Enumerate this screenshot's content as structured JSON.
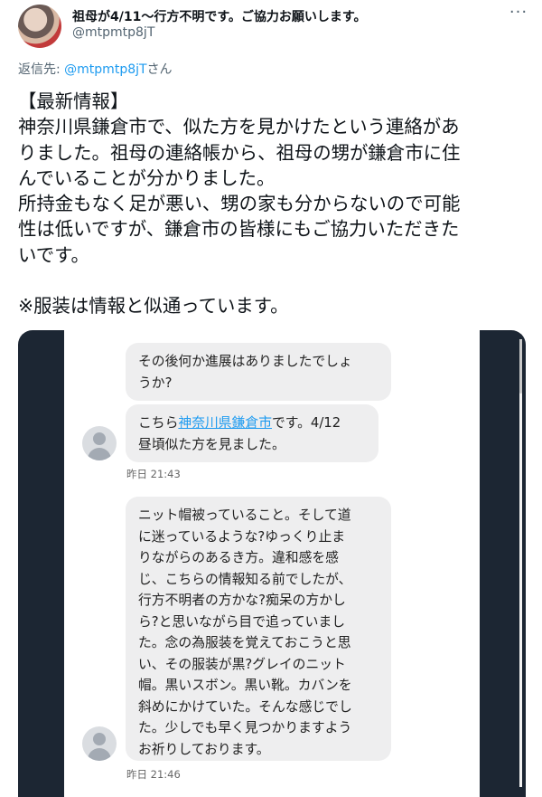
{
  "tweet": {
    "display_name": "祖母が4/11〜行方不明です。ご協力お願いします。",
    "handle": "@mtpmtp8jT",
    "more_icon": "more-horizontal-icon",
    "reply_prefix": "返信先: ",
    "reply_mention": "@mtpmtp8jT",
    "reply_suffix": "さん",
    "body": "【最新情報】\n神奈川県鎌倉市で、似た方を見かけたという連絡があ\nりました。祖母の連絡帳から、祖母の甥が鎌倉市に住\nんでいることが分かりました。\n所持金もなく足が悪い、甥の家も分からないので可能\n性は低いですが、鎌倉市の皆様にもご協力いただきた\nいです。\n\n※服装は情報と似通っています。"
  },
  "chat": {
    "messages": [
      {
        "text": "その後何か進展はありましたでしょ\nうか?"
      },
      {
        "text_pre": "こちら",
        "link": "神奈川県鎌倉市",
        "text_post": "です。4/12\n昼頃似た方を見ました。",
        "timestamp": "昨日 21:43"
      },
      {
        "text": "ニット帽被っていること。そして道\nに迷っているような?ゆっくり止ま\nりながらのあるき方。違和感を感\nじ、こちらの情報知る前でしたが、\n行方不明者の方かな?痴呆の方かし\nら?と思いながら目で追っていまし\nた。念の為服装を覚えておこうと思\nい、その服装が黒?グレイのニット\n帽。黒いスボン。黒い靴。カバンを\n斜めにかけていた。そんな感じでし\nた。少しでも早く見つかりますよう\nお祈りしております。",
        "timestamp": "昨日 21:46"
      }
    ]
  },
  "colors": {
    "link": "#1d9bf0",
    "secondary_text": "#536471",
    "bubble": "#eeeeef",
    "media_frame": "#1c2633"
  }
}
